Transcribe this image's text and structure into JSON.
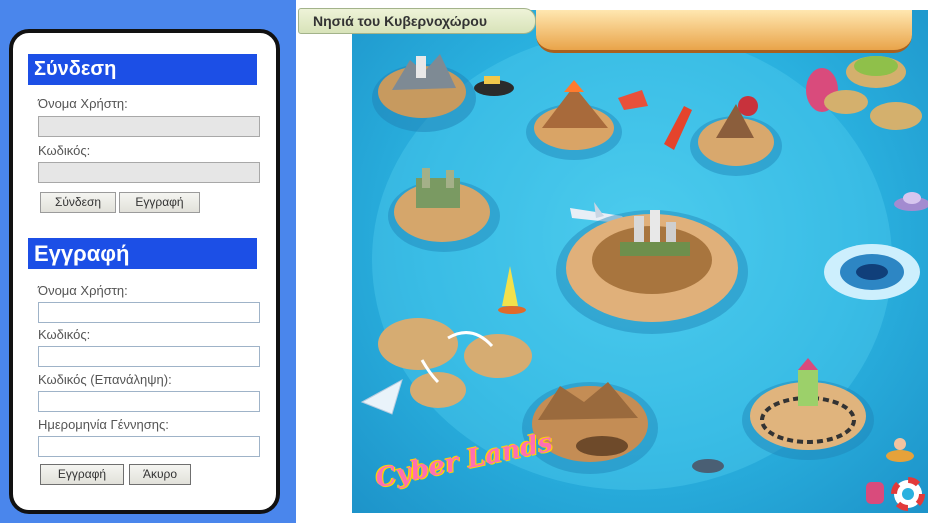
{
  "login": {
    "title": "Σύνδεση",
    "username_label": "Όνομα Χρήστη:",
    "username_value": "",
    "password_label": "Κωδικός:",
    "password_value": "",
    "login_button": "Σύνδεση",
    "register_button": "Εγγραφή"
  },
  "register": {
    "title": "Εγγραφή",
    "username_label": "Όνομα Χρήστη:",
    "password_label": "Κωδικός:",
    "password_repeat_label": "Κωδικός (Επανάληψη):",
    "birthdate_label": "Ημερομηνία Γέννησης:",
    "submit_button": "Εγγραφή",
    "cancel_button": "Άκυρο"
  },
  "map": {
    "title": "Νησιά του Κυβερνοχώρου",
    "logo_text": "Cyber Lands",
    "colors": {
      "panel_bg": "#4a86ec",
      "section_header": "#1c4fe6",
      "sea": "#2ab1df"
    }
  }
}
